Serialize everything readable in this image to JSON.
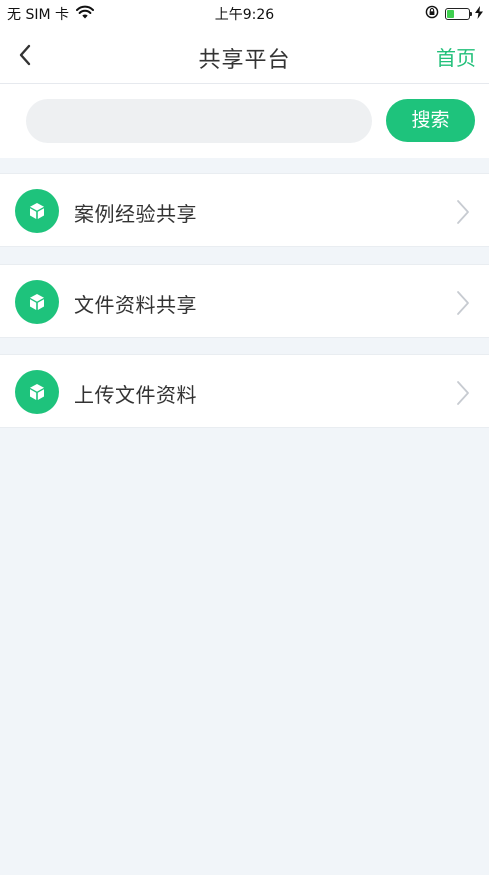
{
  "status_bar": {
    "carrier": "无 SIM 卡",
    "time": "上午9:26",
    "wifi_icon": "wifi-icon",
    "orientation_lock_icon": "orientation-lock-icon",
    "battery_icon": "battery-icon",
    "battery_level_fraction": 0.35,
    "charging_icon": "charging-bolt-icon"
  },
  "nav": {
    "back_icon": "chevron-left-icon",
    "title": "共享平台",
    "home_label": "首页"
  },
  "search": {
    "placeholder": "",
    "value": "",
    "button_label": "搜索"
  },
  "menu": {
    "items": [
      {
        "label": "案例经验共享",
        "icon": "cube-icon"
      },
      {
        "label": "文件资料共享",
        "icon": "cube-icon"
      },
      {
        "label": "上传文件资料",
        "icon": "cube-icon"
      }
    ],
    "chevron_icon": "chevron-right-icon"
  },
  "colors": {
    "accent": "#1ec37c",
    "page_background": "#f1f5f9",
    "search_field_background": "#eef0f2"
  }
}
